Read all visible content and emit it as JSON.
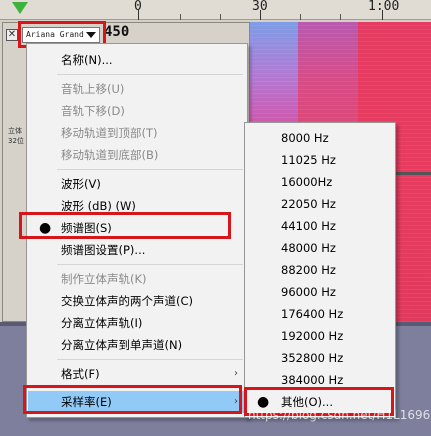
{
  "ruler": {
    "labels": [
      "0",
      "30",
      "1:00"
    ]
  },
  "track": {
    "close_glyph": "✕",
    "name": "Ariana Grand",
    "rate_display": "450",
    "side_text_1": "立体",
    "side_text_2": "32位"
  },
  "menu": {
    "items": [
      {
        "label": "名称(N)...",
        "enabled": true
      },
      {
        "label": "音轨上移(U)",
        "enabled": false
      },
      {
        "label": "音轨下移(D)",
        "enabled": false
      },
      {
        "label": "移动轨道到顶部(T)",
        "enabled": false
      },
      {
        "label": "移动轨道到底部(B)",
        "enabled": false
      },
      {
        "label": "波形(V)",
        "enabled": true
      },
      {
        "label": "波形 (dB) (W)",
        "enabled": true
      },
      {
        "label": "频谱图(S)",
        "enabled": true,
        "checked": true
      },
      {
        "label": "频谱图设置(P)...",
        "enabled": true
      },
      {
        "label": "制作立体声轨(K)",
        "enabled": false
      },
      {
        "label": "交换立体声的两个声道(C)",
        "enabled": true
      },
      {
        "label": "分离立体声轨(I)",
        "enabled": true
      },
      {
        "label": "分离立体声到单声道(N)",
        "enabled": true
      },
      {
        "label": "格式(F)",
        "enabled": true,
        "submenu": true
      },
      {
        "label": "采样率(E)",
        "enabled": true,
        "submenu": true,
        "highlighted": true
      }
    ],
    "check_glyph": "●",
    "submenu_glyph": "›"
  },
  "sample_rate_menu": {
    "items": [
      {
        "label": "8000 Hz"
      },
      {
        "label": "11025 Hz"
      },
      {
        "label": "16000Hz"
      },
      {
        "label": "22050 Hz"
      },
      {
        "label": "44100 Hz"
      },
      {
        "label": "48000 Hz"
      },
      {
        "label": "88200 Hz"
      },
      {
        "label": "96000 Hz"
      },
      {
        "label": "176400 Hz"
      },
      {
        "label": "192000 Hz"
      },
      {
        "label": "352800 Hz"
      },
      {
        "label": "384000 Hz"
      },
      {
        "label": "其他(O)...",
        "checked": true
      }
    ]
  },
  "watermark": "https://blog.csdn.net/H1L1696",
  "colors": {
    "highlight": "#91c9f7",
    "annotation_red": "#d6161b",
    "play_green": "#3cb43c"
  }
}
